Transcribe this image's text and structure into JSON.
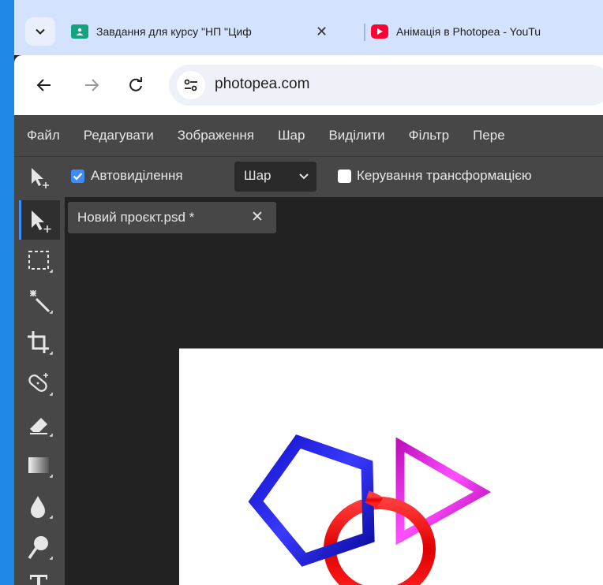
{
  "browser": {
    "tabs": [
      {
        "title": "Завдання для курсу \"НП \"Циф",
        "close": "✕",
        "favicon": "classroom-icon",
        "favicon_color": "#14a37f"
      },
      {
        "title": "Анімація в Photopea - YouTu",
        "favicon": "youtube-icon",
        "favicon_color": "#ff0033"
      }
    ],
    "url": "photopea.com"
  },
  "menu": {
    "items": [
      "Файл",
      "Редагувати",
      "Зображення",
      "Шар",
      "Виділити",
      "Фільтр",
      "Пере"
    ]
  },
  "options": {
    "auto_select_label": "Автовиділення",
    "auto_select_checked": true,
    "target_value": "Шар",
    "transform_controls_label": "Керування трансформацією",
    "transform_controls_checked": false
  },
  "tools": [
    {
      "name": "move-tool-icon",
      "active": true
    },
    {
      "name": "rectangle-select-tool-icon"
    },
    {
      "name": "magic-wand-tool-icon"
    },
    {
      "name": "crop-tool-icon"
    },
    {
      "name": "healing-brush-tool-icon"
    },
    {
      "name": "eraser-tool-icon"
    },
    {
      "name": "gradient-tool-icon"
    },
    {
      "name": "blur-tool-icon"
    },
    {
      "name": "dodge-tool-icon"
    },
    {
      "name": "type-tool-icon"
    }
  ],
  "document": {
    "tab_title": "Новий проєкт.psd *",
    "close": "✕"
  },
  "canvas_shapes": {
    "pentagon_color": "#1a1aff",
    "triangle_color": "#e020e0",
    "ring_color": "#ff1010",
    "background": "#ffffff"
  },
  "colors": {
    "panel_bg": "#474747",
    "workspace_bg": "#222222",
    "accent": "#3b8cff",
    "browser_tabbar": "#d3e3fd"
  }
}
